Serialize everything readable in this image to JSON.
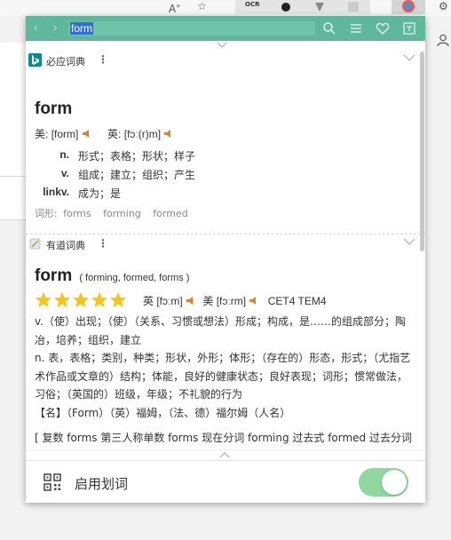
{
  "browser": {
    "reader_icon": "read-aloud-icon",
    "ocr_label": "OCR"
  },
  "search": {
    "value": "form"
  },
  "bing": {
    "name": "必应词典",
    "word": "form",
    "us_label": "美:",
    "us_phonetic": "[form]",
    "uk_label": "英:",
    "uk_phonetic": "[fɔː(r)m]",
    "definitions": [
      {
        "pos": "n.",
        "text": "形式；表格；形状；样子"
      },
      {
        "pos": "v.",
        "text": "组成；建立；组织；产生"
      },
      {
        "pos": "linkv.",
        "text": "成为；是"
      }
    ],
    "forms_label": "词形:",
    "forms": [
      "forms",
      "forming",
      "formed"
    ]
  },
  "youdao": {
    "name": "有道词典",
    "word": "form",
    "inflections": "( forming, formed, forms )",
    "stars": 5,
    "uk_phonetic": "英 [fɔːm]",
    "us_phonetic": "美 [fɔːrm]",
    "exam_tags": "CET4 TEM4",
    "definition_v": "v.（使）出现；（使）（关系、习惯或想法）形成；构成，是……的组成部分；陶冶，培养；组织，建立",
    "definition_n": "n. 表，表格；类别，种类；形状，外形；体形；（存在的）形态，形式；（尤指艺术作品或文章的）结构；体能，良好的健康状态；良好表现；词形；惯常做法，习俗；（英国的）班级，年级；不礼貌的行为",
    "definition_name": "【名】（Form）（英）福姆，（法、德）福尔姆（人名）",
    "word_forms": "[ 复数 forms 第三人称单数 forms 现在分词 forming 过去式 formed 过去分词 formed ]"
  },
  "footer": {
    "label": "启用划词",
    "toggle_on": true
  },
  "colors": {
    "accent": "#5fb89b",
    "star": "#f5c518",
    "speaker": "#f07c22",
    "toggle": "#8fd89f"
  }
}
